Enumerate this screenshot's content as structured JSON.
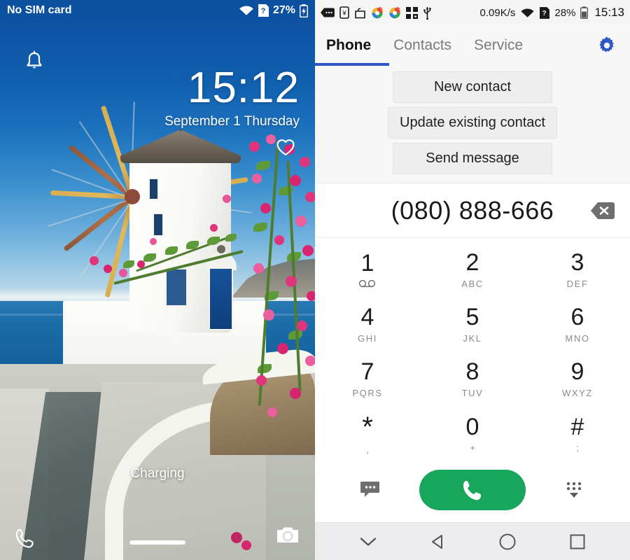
{
  "lockscreen": {
    "status_bar": {
      "carrier": "No SIM card",
      "battery_percent": "27%",
      "icons": [
        "wifi-icon",
        "sim-unknown-icon",
        "battery-charging-icon"
      ]
    },
    "notification_icon": "bell-icon",
    "time": "15:12",
    "date": "September 1 Thursday",
    "favorite_icon": "heart-icon",
    "charging_label": "Charging",
    "shortcut_left": "phone-icon",
    "shortcut_right": "camera-icon",
    "home_indicator": "home-indicator"
  },
  "dialer": {
    "status_bar": {
      "notification_icons": [
        "messages-icon",
        "wallet-icon",
        "shopping-bag-icon",
        "browser-icon",
        "browser-icon-2",
        "qr-grid-icon",
        "usb-icon"
      ],
      "network_speed": "0.09K/s",
      "battery_percent": "28%",
      "time": "15:13",
      "icons": [
        "wifi-icon",
        "sim-unknown-icon",
        "battery-icon"
      ]
    },
    "tabs": [
      {
        "label": "Phone",
        "active": true
      },
      {
        "label": "Contacts",
        "active": false
      },
      {
        "label": "Service",
        "active": false
      }
    ],
    "settings_icon": "gear-icon",
    "suggestions": [
      {
        "label": "New contact"
      },
      {
        "label": "Update existing contact"
      },
      {
        "label": "Send message"
      }
    ],
    "number_display": {
      "value": "(080) 888-666",
      "clear_icon": "backspace-icon"
    },
    "keypad": [
      {
        "digit": "1",
        "sub": "",
        "sub_icon": "voicemail-icon"
      },
      {
        "digit": "2",
        "sub": "ABC",
        "sub_icon": ""
      },
      {
        "digit": "3",
        "sub": "DEF",
        "sub_icon": ""
      },
      {
        "digit": "4",
        "sub": "GHI",
        "sub_icon": ""
      },
      {
        "digit": "5",
        "sub": "JKL",
        "sub_icon": ""
      },
      {
        "digit": "6",
        "sub": "MNO",
        "sub_icon": ""
      },
      {
        "digit": "7",
        "sub": "PQRS",
        "sub_icon": ""
      },
      {
        "digit": "8",
        "sub": "TUV",
        "sub_icon": ""
      },
      {
        "digit": "9",
        "sub": "WXYZ",
        "sub_icon": ""
      },
      {
        "digit": "*",
        "sub": ",",
        "sub_icon": ""
      },
      {
        "digit": "0",
        "sub": "+",
        "sub_icon": ""
      },
      {
        "digit": "#",
        "sub": ";",
        "sub_icon": ""
      }
    ],
    "actions": {
      "message_icon": "message-bubble-icon",
      "call_icon": "phone-call-icon",
      "hide_keypad_icon": "dialpad-collapse-icon"
    },
    "navbar": [
      {
        "icon": "chevron-down-icon"
      },
      {
        "icon": "back-triangle-icon"
      },
      {
        "icon": "home-circle-icon"
      },
      {
        "icon": "recents-square-icon"
      }
    ]
  },
  "colors": {
    "accent_blue": "#2f55c7",
    "call_green": "#17a65b",
    "sky_top": "#0b4f9e",
    "sea": "#1b6ba8",
    "panel_gray": "#f7f7f7",
    "button_gray": "#eeeeee"
  }
}
